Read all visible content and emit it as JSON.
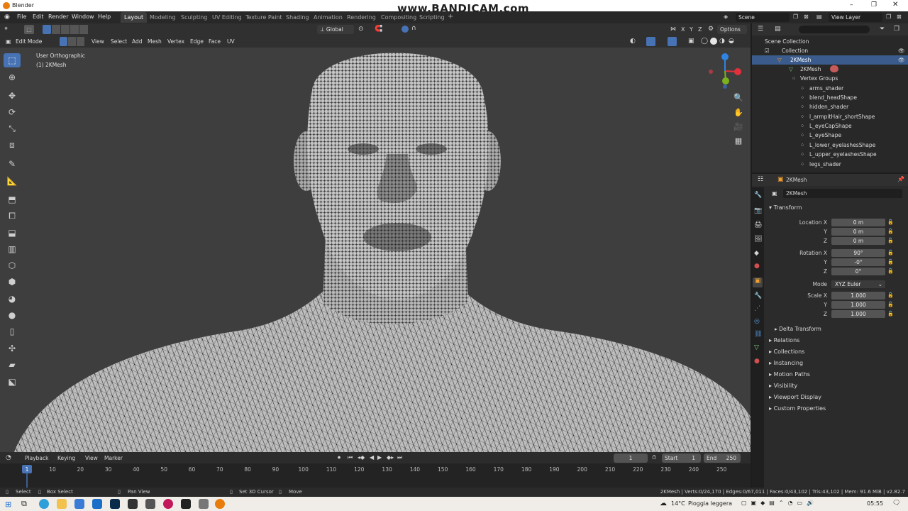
{
  "window": {
    "title": "Blender",
    "watermark": "www.BANDICAM.com"
  },
  "menu": {
    "items": [
      "File",
      "Edit",
      "Render",
      "Window",
      "Help"
    ]
  },
  "workspaces": [
    "Layout",
    "Modeling",
    "Sculpting",
    "UV Editing",
    "Texture Paint",
    "Shading",
    "Animation",
    "Rendering",
    "Compositing",
    "Scripting"
  ],
  "scene": {
    "label": "Scene",
    "view_layer": "View Layer"
  },
  "tool_header": {
    "orientation": "Global",
    "options": "Options",
    "axes": [
      "X",
      "Y",
      "Z"
    ]
  },
  "mode_header": {
    "mode": "Edit Mode",
    "menus": [
      "View",
      "Select",
      "Add",
      "Mesh",
      "Vertex",
      "Edge",
      "Face",
      "UV"
    ]
  },
  "viewport": {
    "view_name": "User Orthographic",
    "object_info": "(1) 2KMesh"
  },
  "outliner": {
    "search_placeholder": "",
    "rows": [
      {
        "label": "Scene Collection"
      },
      {
        "label": "Collection"
      },
      {
        "label": "2KMesh"
      },
      {
        "label": "2KMesh"
      },
      {
        "label": "Vertex Groups"
      },
      {
        "label": "arms_shader"
      },
      {
        "label": "blend_headShape"
      },
      {
        "label": "hidden_shader"
      },
      {
        "label": "l_armpitHair_shortShape"
      },
      {
        "label": "L_eyeCapShape"
      },
      {
        "label": "L_eyeShape"
      },
      {
        "label": "L_lower_eyelashesShape"
      },
      {
        "label": "L_upper_eyelashesShape"
      },
      {
        "label": "legs_shader"
      }
    ]
  },
  "properties": {
    "object_name": "2KMesh",
    "name_field": "2KMesh",
    "transform_label": "Transform",
    "location_label": "Location X",
    "location": [
      "0 m",
      "0 m",
      "0 m"
    ],
    "rotation_label": "Rotation X",
    "rotation": [
      "90°",
      "-0°",
      "0°"
    ],
    "mode_label": "Mode",
    "mode_value": "XYZ Euler",
    "scale_label": "Scale X",
    "scale": [
      "1.000",
      "1.000",
      "1.000"
    ],
    "axis_y": "Y",
    "axis_z": "Z",
    "delta": "Delta Transform",
    "sections": [
      "Relations",
      "Collections",
      "Instancing",
      "Motion Paths",
      "Visibility",
      "Viewport Display",
      "Custom Properties"
    ]
  },
  "timeline": {
    "menus": [
      "Playback",
      "Keying",
      "View",
      "Marker"
    ],
    "current_frame": "1",
    "start_label": "Start",
    "start": "1",
    "end_label": "End",
    "end": "250",
    "ticks": [
      "10",
      "20",
      "30",
      "40",
      "50",
      "60",
      "70",
      "80",
      "90",
      "100",
      "110",
      "120",
      "130",
      "140",
      "150",
      "160",
      "170",
      "180",
      "190",
      "200",
      "210",
      "220",
      "230",
      "240",
      "250"
    ],
    "marker": "1"
  },
  "status": {
    "select": "Select",
    "box_select": "Box Select",
    "pan_view": "Pan View",
    "set_cursor": "Set 3D Cursor",
    "move": "Move",
    "stats": "2KMesh | Verts:0/24,170 | Edges:0/67,011 | Faces:0/43,102 | Tris:43,102 | Mem: 91.6 MiB | v2.82.7"
  },
  "taskbar": {
    "weather": "14°C",
    "weather_text": "Pioggia leggera",
    "time": "05:55"
  },
  "colors": {
    "accent": "#4772b3",
    "selection": "#3a5b8c",
    "viewport": "#3e3e3e",
    "mesh": "#bdbdbd"
  }
}
